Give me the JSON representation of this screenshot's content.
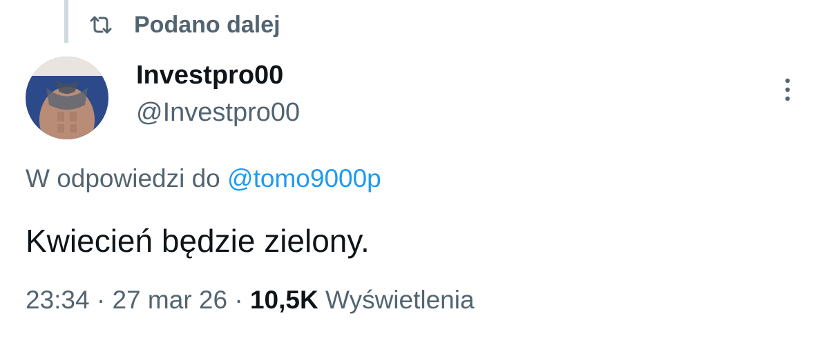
{
  "repost": {
    "label": "Podano dalej",
    "icon": "repost-icon"
  },
  "author": {
    "display_name": "Investpro00",
    "handle": "@Investpro00",
    "avatar": "avatar-image"
  },
  "reply_to": {
    "prefix": "W odpowiedzi do",
    "mention": "@tomo9000p"
  },
  "tweet": {
    "text": "Kwiecień będzie zielony."
  },
  "meta": {
    "time": "23:34",
    "separator": "·",
    "date": "27 mar 26",
    "views_count": "10,5K",
    "views_label": "Wyświetlenia"
  },
  "colors": {
    "secondary_text": "#536471",
    "primary_text": "#0f1419",
    "link": "#1d9bf0",
    "thread_line": "#cfd9de"
  }
}
